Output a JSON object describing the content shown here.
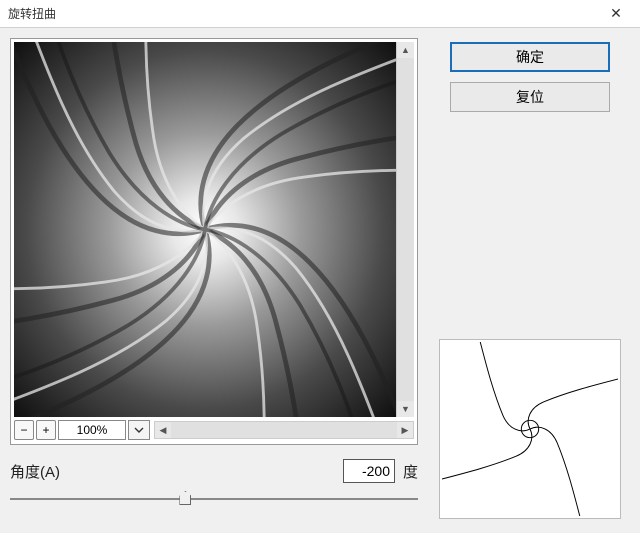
{
  "dialog": {
    "title": "旋转扭曲",
    "close_glyph": "✕"
  },
  "zoom": {
    "minus_glyph": "−",
    "plus_glyph": "+",
    "value": "100%"
  },
  "buttons": {
    "ok": "确定",
    "reset": "复位"
  },
  "angle": {
    "label": "角度(A)",
    "value": "-200",
    "unit": "度",
    "slider_percent": 43
  }
}
